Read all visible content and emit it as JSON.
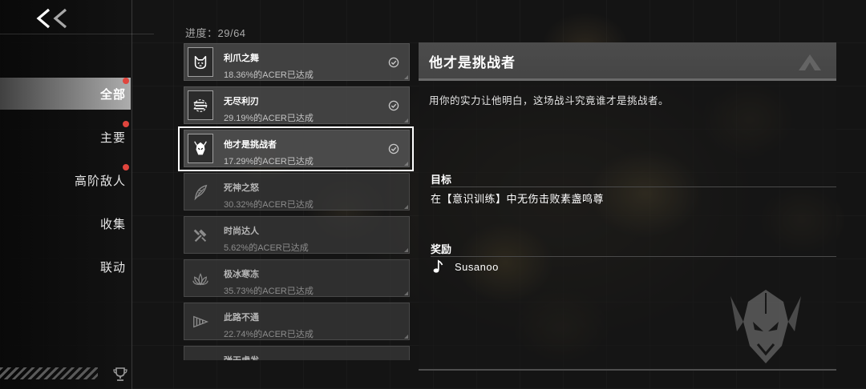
{
  "nav": {
    "back_icon": "double-chevron-left-icon"
  },
  "sidebar": {
    "items": [
      {
        "label": "全部",
        "selected": true,
        "badge": true
      },
      {
        "label": "主要",
        "selected": false,
        "badge": true
      },
      {
        "label": "高阶敌人",
        "selected": false,
        "badge": true
      },
      {
        "label": "收集",
        "selected": false,
        "badge": false
      },
      {
        "label": "联动",
        "selected": false,
        "badge": false
      }
    ],
    "footer_icon": "trophy-icon"
  },
  "progress": {
    "label": "进度：29/64"
  },
  "achievements": [
    {
      "title": "利爪之舞",
      "rate": "18.36%的ACER已达成",
      "completed": true,
      "selected": false,
      "icon": "cat-claw-icon"
    },
    {
      "title": "无尽利刃",
      "rate": "29.19%的ACER已达成",
      "completed": true,
      "selected": false,
      "icon": "blades-icon"
    },
    {
      "title": "他才是挑战者",
      "rate": "17.29%的ACER已达成",
      "completed": true,
      "selected": true,
      "icon": "helmet-icon"
    },
    {
      "title": "死神之怒",
      "rate": "30.32%的ACER已达成",
      "completed": false,
      "selected": false,
      "icon": "feather-icon"
    },
    {
      "title": "时尚达人",
      "rate": "5.62%的ACER已达成",
      "completed": false,
      "selected": false,
      "icon": "hammer-brush-icon"
    },
    {
      "title": "极冰寒冻",
      "rate": "35.73%的ACER已达成",
      "completed": false,
      "selected": false,
      "icon": "ice-flower-icon"
    },
    {
      "title": "此路不通",
      "rate": "22.74%的ACER已达成",
      "completed": false,
      "selected": false,
      "icon": "drill-cone-icon"
    },
    {
      "title": "弹无虚发",
      "completed": false,
      "selected": false,
      "icon": "arrow-icon"
    }
  ],
  "check_icon": "check-circle-icon",
  "detail": {
    "title": "他才是挑战者",
    "logo_icon": "game-logo-icon",
    "description": "用你的实力让他明白，这场战斗究竟谁才是挑战者。",
    "objective_heading": "目标",
    "objective": "在【意识训练】中无伤击败素盏鸣尊",
    "reward_heading": "奖励",
    "reward_icon": "music-note-icon",
    "reward": "Susanoo",
    "emblem_icon": "susanoo-helmet-icon"
  },
  "colors": {
    "badge": "#e0453d",
    "selected_outline": "#ffffff",
    "panel_header": "#454545"
  }
}
